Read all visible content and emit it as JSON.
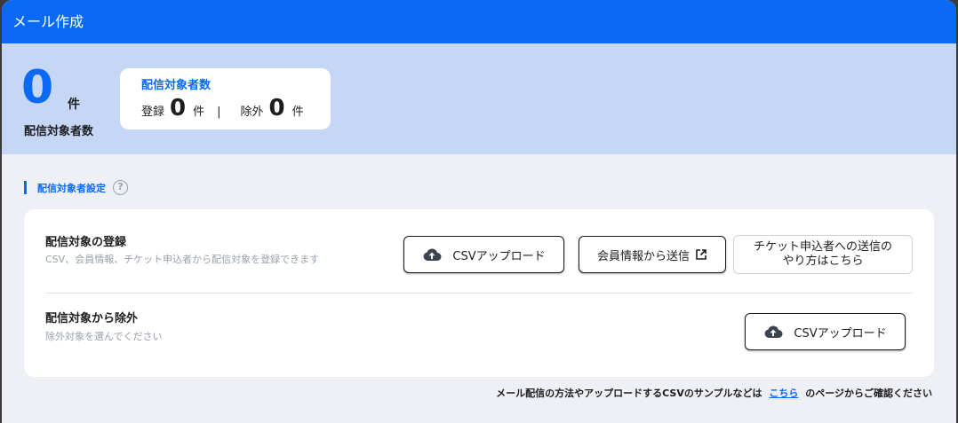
{
  "window": {
    "title": "メール作成"
  },
  "summary": {
    "count": "0",
    "unit": "件",
    "label": "配信対象者数",
    "breakdown": {
      "title": "配信対象者数",
      "registered_label": "登録",
      "registered_count": "0",
      "registered_unit": "件",
      "separator": "|",
      "excluded_label": "除外",
      "excluded_count": "0",
      "excluded_unit": "件"
    }
  },
  "settings": {
    "title": "配信対象者設定",
    "help_icon": "?",
    "register": {
      "title": "配信対象の登録",
      "description": "CSV、会員情報、チケット申込者から配信対象を登録できます",
      "csv_button": "CSVアップロード",
      "member_button": "会員情報から送信",
      "ticket_button_line1": "チケット申込者への送信の",
      "ticket_button_line2": "やり方はこちら"
    },
    "exclude": {
      "title": "配信対象から除外",
      "description": "除外対象を選んでください",
      "csv_button": "CSVアップロード"
    }
  },
  "footer": {
    "before": "メール配信の方法やアップロードするCSVのサンプルなどは",
    "link": "こちら",
    "after": "のページからご確認ください"
  },
  "colors": {
    "accent": "#0a6af5",
    "summary_bg": "#c5d7f5",
    "page_bg": "#eef0f5"
  },
  "icons": [
    "cloud-upload-icon",
    "external-link-icon",
    "help-icon"
  ]
}
